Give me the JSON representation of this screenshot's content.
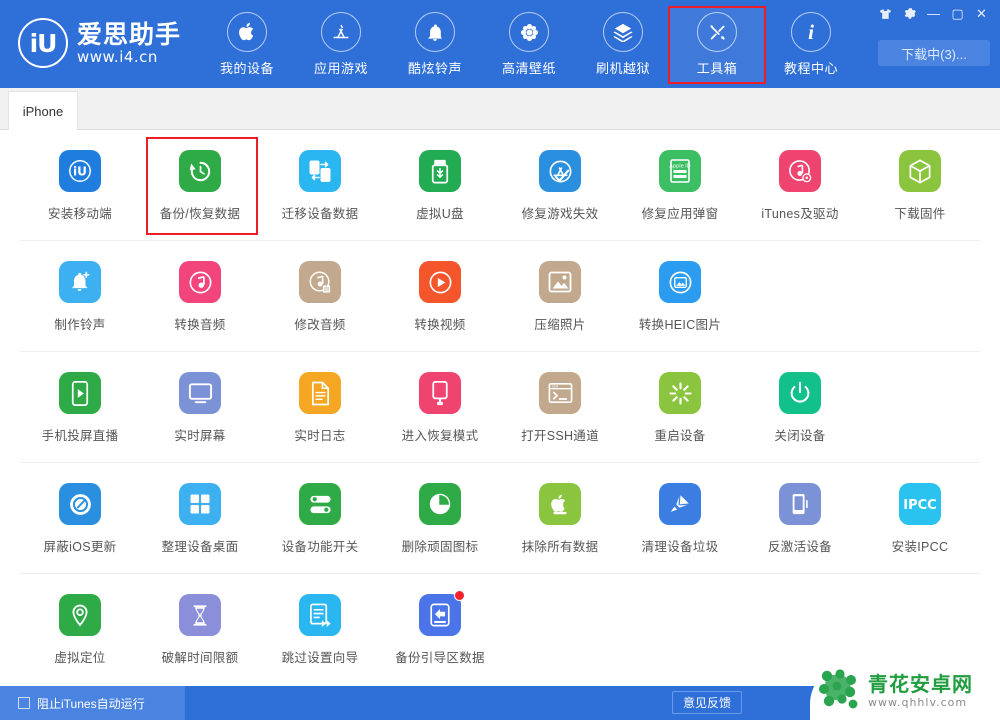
{
  "brand": {
    "mark": "iU",
    "name_cn": "爱思助手",
    "url": "www.i4.cn"
  },
  "header": {
    "nav": [
      {
        "label": "我的设备",
        "icon": "apple-icon",
        "highlight": false
      },
      {
        "label": "应用游戏",
        "icon": "appstore-icon",
        "highlight": false
      },
      {
        "label": "酷炫铃声",
        "icon": "bell-icon",
        "highlight": false
      },
      {
        "label": "高清壁纸",
        "icon": "flower-icon",
        "highlight": false
      },
      {
        "label": "刷机越狱",
        "icon": "flash-box-icon",
        "highlight": false
      },
      {
        "label": "工具箱",
        "icon": "tools-icon",
        "highlight": true
      },
      {
        "label": "教程中心",
        "icon": "info-icon",
        "highlight": false
      }
    ],
    "window_buttons": [
      {
        "name": "skin-icon",
        "glyph": "♣"
      },
      {
        "name": "settings-gear-icon",
        "glyph": "⚙"
      },
      {
        "name": "minimize-icon",
        "glyph": "—"
      },
      {
        "name": "maximize-icon",
        "glyph": "▢"
      },
      {
        "name": "close-icon",
        "glyph": "✕"
      }
    ],
    "download_button": "下载中(3)..."
  },
  "tabs": [
    {
      "label": "iPhone",
      "active": true
    }
  ],
  "toolbox": {
    "rows": [
      {
        "items": [
          {
            "label": "安装移动端",
            "icon": "i4-app-icon",
            "color": "#1f7de0",
            "badge": false,
            "highlight": false
          },
          {
            "label": "备份/恢复数据",
            "icon": "backup-restore-icon",
            "color": "#2eaa47",
            "badge": false,
            "highlight": true
          },
          {
            "label": "迁移设备数据",
            "icon": "migrate-device-icon",
            "color": "#2ab6f0",
            "badge": false,
            "highlight": false
          },
          {
            "label": "虚拟U盘",
            "icon": "usb-drive-icon",
            "color": "#23ab54",
            "badge": false,
            "highlight": false
          },
          {
            "label": "修复游戏失效",
            "icon": "appstore-fix-icon",
            "color": "#2b8fe0",
            "badge": false,
            "highlight": false
          },
          {
            "label": "修复应用弹窗",
            "icon": "appleid-popup-icon",
            "color": "#3cbe63",
            "badge": false,
            "highlight": false
          },
          {
            "label": "iTunes及驱动",
            "icon": "itunes-driver-icon",
            "color": "#ef4470",
            "badge": false,
            "highlight": false
          },
          {
            "label": "下载固件",
            "icon": "firmware-box-icon",
            "color": "#8bc53f",
            "badge": false,
            "highlight": false
          }
        ]
      },
      {
        "items": [
          {
            "label": "制作铃声",
            "icon": "ringtone-make-icon",
            "color": "#3cb0f0",
            "badge": false,
            "highlight": false
          },
          {
            "label": "转换音频",
            "icon": "audio-convert-icon",
            "color": "#f2457c",
            "badge": false,
            "highlight": false
          },
          {
            "label": "修改音频",
            "icon": "audio-edit-icon",
            "color": "#c2a88c",
            "badge": false,
            "highlight": false
          },
          {
            "label": "转换视频",
            "icon": "video-convert-icon",
            "color": "#f5552b",
            "badge": false,
            "highlight": false
          },
          {
            "label": "压缩照片",
            "icon": "photo-compress-icon",
            "color": "#c2a88c",
            "badge": false,
            "highlight": false
          },
          {
            "label": "转换HEIC图片",
            "icon": "heic-convert-icon",
            "color": "#2b9cf0",
            "badge": false,
            "highlight": false
          }
        ]
      },
      {
        "items": [
          {
            "label": "手机投屏直播",
            "icon": "screen-cast-icon",
            "color": "#2eaa47",
            "badge": false,
            "highlight": false
          },
          {
            "label": "实时屏幕",
            "icon": "realtime-screen-icon",
            "color": "#7b93d6",
            "badge": false,
            "highlight": false
          },
          {
            "label": "实时日志",
            "icon": "realtime-log-icon",
            "color": "#f5a623",
            "badge": false,
            "highlight": false
          },
          {
            "label": "进入恢复模式",
            "icon": "recovery-mode-icon",
            "color": "#ef4470",
            "badge": false,
            "highlight": false
          },
          {
            "label": "打开SSH通道",
            "icon": "ssh-terminal-icon",
            "color": "#c2a88c",
            "badge": false,
            "highlight": false
          },
          {
            "label": "重启设备",
            "icon": "reboot-icon",
            "color": "#8bc53f",
            "badge": false,
            "highlight": false
          },
          {
            "label": "关闭设备",
            "icon": "shutdown-icon",
            "color": "#12c08a",
            "badge": false,
            "highlight": false
          }
        ]
      },
      {
        "items": [
          {
            "label": "屏蔽iOS更新",
            "icon": "block-update-icon",
            "color": "#2b8fe0",
            "badge": false,
            "highlight": false
          },
          {
            "label": "整理设备桌面",
            "icon": "arrange-desktop-icon",
            "color": "#3cb0f0",
            "badge": false,
            "highlight": false
          },
          {
            "label": "设备功能开关",
            "icon": "feature-toggle-icon",
            "color": "#2eaa47",
            "badge": false,
            "highlight": false
          },
          {
            "label": "删除顽固图标",
            "icon": "remove-icon-icon",
            "color": "#2eaa47",
            "badge": false,
            "highlight": false
          },
          {
            "label": "抹除所有数据",
            "icon": "erase-all-icon",
            "color": "#8bc53f",
            "badge": false,
            "highlight": false
          },
          {
            "label": "清理设备垃圾",
            "icon": "clean-junk-icon",
            "color": "#3b7de0",
            "badge": false,
            "highlight": false
          },
          {
            "label": "反激活设备",
            "icon": "deactivate-icon",
            "color": "#7b93d6",
            "badge": false,
            "highlight": false
          },
          {
            "label": "安装IPCC",
            "icon": "ipcc-install-icon",
            "color": "#2ac3f0",
            "badge": false,
            "highlight": false
          }
        ]
      },
      {
        "items": [
          {
            "label": "虚拟定位",
            "icon": "virtual-location-icon",
            "color": "#2eaa47",
            "badge": false,
            "highlight": false
          },
          {
            "label": "破解时间限额",
            "icon": "time-limit-icon",
            "color": "#8b8ed8",
            "badge": false,
            "highlight": false
          },
          {
            "label": "跳过设置向导",
            "icon": "skip-setup-icon",
            "color": "#2ab6f0",
            "badge": false,
            "highlight": false
          },
          {
            "label": "备份引导区数据",
            "icon": "boot-backup-icon",
            "color": "#4a74e8",
            "badge": true,
            "highlight": false
          }
        ]
      }
    ]
  },
  "footer": {
    "block_itunes_label": "阻止iTunes自动运行",
    "block_itunes_checked": false,
    "feedback_label": "意见反馈"
  },
  "watermark": {
    "name_cn": "青花安卓网",
    "url": "www.qhhlv.com",
    "color": "#1f9d3f"
  }
}
